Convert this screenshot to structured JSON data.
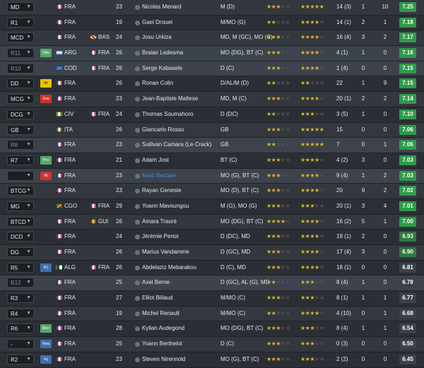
{
  "colors": {
    "rating_high": "#2f9a4a",
    "rating_mid": "#2f7a3f",
    "rating_low": "#3b4148",
    "star_filled": "#e0b52b",
    "link_name": "#3b8fe0",
    "france": [
      "#0055a4",
      "#ffffff",
      "#ef4135"
    ]
  },
  "players": [
    {
      "pos": "MD",
      "role": "",
      "role_color": "",
      "nat": "FRA",
      "flag": "fra",
      "nat2": "",
      "flag2": "",
      "age": "23",
      "name": "Nicolas Menard",
      "position": "M (D)",
      "ca": "★★★☆☆",
      "pa": "★★★★★",
      "apps": "14 (3)",
      "goals": "1",
      "assists": "10",
      "rating": "7.25",
      "rating_color": "#2f9a4a",
      "rating_text": "#ffffff",
      "style": "alt",
      "name_link": false,
      "dim": false
    },
    {
      "pos": "R1",
      "role": "",
      "role_color": "",
      "nat": "FRA",
      "flag": "fra",
      "nat2": "",
      "flag2": "",
      "age": "19",
      "name": "Gael Drouet",
      "position": "M/MO (G)",
      "ca": "★★☆☆☆",
      "pa": "★★★★☆",
      "apps": "14 (1)",
      "goals": "2",
      "assists": "1",
      "rating": "7.18",
      "rating_color": "#2f9a4a",
      "rating_text": "#ffffff",
      "style": "base",
      "name_link": false,
      "dim": false
    },
    {
      "pos": "MCD",
      "role": "",
      "role_color": "",
      "nat": "FRA",
      "flag": "fra",
      "nat2": "BAS",
      "flag2": "bas",
      "age": "24",
      "name": "Josu Urkiza",
      "position": "MD, M (GC), MO (C)",
      "ca": "★★★☆☆",
      "pa": "★★★★☆",
      "apps": "16 (4)",
      "goals": "3",
      "assists": "2",
      "rating": "7.17",
      "rating_color": "#2f9a4a",
      "rating_text": "#ffffff",
      "style": "alt",
      "name_link": false,
      "dim": false
    },
    {
      "pos": "R11",
      "role": "Otie",
      "role_color": "#55a86b",
      "nat": "ARG",
      "flag": "arg",
      "nat2": "FRA",
      "flag2": "fra",
      "age": "26",
      "name": "Braian Ledesma",
      "position": "MO (DG), BT (C)",
      "ca": "★★★☆☆",
      "pa": "★★★★☆",
      "apps": "4 (1)",
      "goals": "1",
      "assists": "0",
      "rating": "7.16",
      "rating_color": "#2f9a4a",
      "rating_text": "#ffffff",
      "style": "sel",
      "name_link": false,
      "dim": true
    },
    {
      "pos": "R10",
      "role": "",
      "role_color": "",
      "nat": "COD",
      "flag": "cod",
      "nat2": "FRA",
      "flag2": "fra",
      "age": "26",
      "name": "Serge Kabasele",
      "position": "D (C)",
      "ca": "★★★☆☆",
      "pa": "★★★★☆",
      "apps": "1 (4)",
      "goals": "0",
      "assists": "0",
      "rating": "7.15",
      "rating_color": "#2f9a4a",
      "rating_text": "#ffffff",
      "style": "sel",
      "name_link": false,
      "dim": true
    },
    {
      "pos": "DD",
      "role": "Ar",
      "role_color": "#e8c400",
      "nat": "FRA",
      "flag": "fra",
      "nat2": "",
      "flag2": "",
      "age": "26",
      "name": "Ronan Colin",
      "position": "D/AL/M (D)",
      "ca": "★★☆☆☆",
      "pa": "★★☆☆☆",
      "apps": "22",
      "goals": "1",
      "assists": "9",
      "rating": "7.15",
      "rating_color": "#2f9a4a",
      "rating_text": "#ffffff",
      "style": "base",
      "name_link": false,
      "dim": false
    },
    {
      "pos": "MCG",
      "role": "Sus",
      "role_color": "#d0342c",
      "nat": "FRA",
      "flag": "fra",
      "nat2": "",
      "flag2": "",
      "age": "23",
      "name": "Jean-Baptiste Maltese",
      "position": "MD, M (C)",
      "ca": "★★★☆☆",
      "pa": "★★★★☆",
      "apps": "20 (1)",
      "goals": "2",
      "assists": "2",
      "rating": "7.14",
      "rating_color": "#2f9a4a",
      "rating_text": "#ffffff",
      "style": "alt",
      "name_link": false,
      "dim": false
    },
    {
      "pos": "DCG",
      "role": "",
      "role_color": "",
      "nat": "CIV",
      "flag": "civ",
      "nat2": "FRA",
      "flag2": "fra",
      "age": "24",
      "name": "Thomas Soumahoro",
      "position": "D (DC)",
      "ca": "★★☆☆☆",
      "pa": "★★★☆☆",
      "apps": "3 (5)",
      "goals": "1",
      "assists": "0",
      "rating": "7.10",
      "rating_color": "#2f9a4a",
      "rating_text": "#ffffff",
      "style": "base",
      "name_link": false,
      "dim": false
    },
    {
      "pos": "GB",
      "role": "",
      "role_color": "",
      "nat": "ITA",
      "flag": "ita",
      "nat2": "",
      "flag2": "",
      "age": "26",
      "name": "Giancarlo Rosso",
      "position": "GB",
      "ca": "★★★☆☆",
      "pa": "★★★★★",
      "apps": "15",
      "goals": "0",
      "assists": "0",
      "rating": "7.06",
      "rating_color": "#2f9a4a",
      "rating_text": "#ffffff",
      "style": "alt",
      "name_link": false,
      "dim": false
    },
    {
      "pos": "R8",
      "role": "",
      "role_color": "",
      "nat": "FRA",
      "flag": "fra",
      "nat2": "",
      "flag2": "",
      "age": "23",
      "name": "Sullivan Camara (Le Crack)",
      "position": "GB",
      "ca": "★★☆☆☆",
      "pa": "★★★★★",
      "apps": "7",
      "goals": "0",
      "assists": "1",
      "rating": "7.06",
      "rating_color": "#2f9a4a",
      "rating_text": "#ffffff",
      "style": "sel",
      "name_link": false,
      "dim": true
    },
    {
      "pos": "R7",
      "role": "Pro",
      "role_color": "#55a86b",
      "nat": "FRA",
      "flag": "fra",
      "nat2": "",
      "flag2": "",
      "age": "21",
      "name": "Adam Jost",
      "position": "BT (C)",
      "ca": "★★★☆☆",
      "pa": "★★★★☆",
      "apps": "4 (2)",
      "goals": "3",
      "assists": "0",
      "rating": "7.03",
      "rating_color": "#2f9a4a",
      "rating_text": "#ffffff",
      "style": "base",
      "name_link": false,
      "dim": false
    },
    {
      "pos": "",
      "role": "Nl",
      "role_color": "#d0342c",
      "nat": "FRA",
      "flag": "fra",
      "nat2": "",
      "flag2": "",
      "age": "23",
      "name": "Marc Barzaei",
      "position": "MO (G), BT (C)",
      "ca": "★★★☆☆",
      "pa": "★★★★☆",
      "apps": "9 (4)",
      "goals": "1",
      "assists": "2",
      "rating": "7.03",
      "rating_color": "#2f9a4a",
      "rating_text": "#ffffff",
      "style": "sel",
      "name_link": true,
      "dim": false
    },
    {
      "pos": "BTCG",
      "role": "",
      "role_color": "",
      "nat": "FRA",
      "flag": "fra",
      "nat2": "",
      "flag2": "",
      "age": "23",
      "name": "Rayan Geneste",
      "position": "MO (D), BT (C)",
      "ca": "★★★☆☆",
      "pa": "★★★★☆",
      "apps": "20",
      "goals": "9",
      "assists": "2",
      "rating": "7.02",
      "rating_color": "#2f9a4a",
      "rating_text": "#ffffff",
      "style": "alt",
      "name_link": false,
      "dim": false
    },
    {
      "pos": "MG",
      "role": "",
      "role_color": "",
      "nat": "CGO",
      "flag": "cgo",
      "nat2": "FRA",
      "flag2": "fra",
      "age": "29",
      "name": "Yoann Mavoungou",
      "position": "M (G), MO (G)",
      "ca": "★★★☆☆",
      "pa": "★★★☆☆",
      "apps": "20 (1)",
      "goals": "3",
      "assists": "4",
      "rating": "7.01",
      "rating_color": "#2f9a4a",
      "rating_text": "#ffffff",
      "style": "base",
      "name_link": false,
      "dim": false
    },
    {
      "pos": "BTCD",
      "role": "",
      "role_color": "",
      "nat": "FRA",
      "flag": "fra",
      "nat2": "GUI",
      "flag2": "gui",
      "age": "26",
      "name": "Amara Traoré",
      "position": "MO (DG), BT (C)",
      "ca": "★★★★☆",
      "pa": "★★★★☆",
      "apps": "16 (2)",
      "goals": "5",
      "assists": "1",
      "rating": "7.00",
      "rating_color": "#2f9a4a",
      "rating_text": "#ffffff",
      "style": "alt",
      "name_link": false,
      "dim": false
    },
    {
      "pos": "DCD",
      "role": "",
      "role_color": "",
      "nat": "FRA",
      "flag": "fra",
      "nat2": "",
      "flag2": "",
      "age": "24",
      "name": "Jérémie Penot",
      "position": "D (DC), MD",
      "ca": "★★★☆☆",
      "pa": "★★★★☆",
      "apps": "19 (1)",
      "goals": "2",
      "assists": "0",
      "rating": "6.93",
      "rating_color": "#2f7a3f",
      "rating_text": "#ffffff",
      "style": "base",
      "name_link": false,
      "dim": false
    },
    {
      "pos": "DG",
      "role": "",
      "role_color": "",
      "nat": "FRA",
      "flag": "fra",
      "nat2": "",
      "flag2": "",
      "age": "26",
      "name": "Marius Vandamme",
      "position": "D (GC), MD",
      "ca": "★★★☆☆",
      "pa": "★★★★☆",
      "apps": "17 (4)",
      "goals": "3",
      "assists": "0",
      "rating": "6.90",
      "rating_color": "#2f7a3f",
      "rating_text": "#ffffff",
      "style": "alt",
      "name_link": false,
      "dim": false
    },
    {
      "pos": "R5",
      "role": "RJ",
      "role_color": "#3f6fb0",
      "nat": "ALG",
      "flag": "alg",
      "nat2": "FRA",
      "flag2": "fra",
      "age": "26",
      "name": "Abdelaziz Mebarakou",
      "position": "D (C), MD",
      "ca": "★★★☆☆",
      "pa": "★★★★☆",
      "apps": "18 (1)",
      "goals": "0",
      "assists": "0",
      "rating": "6.81",
      "rating_color": "#3b4148",
      "rating_text": "#ffffff",
      "style": "base",
      "name_link": false,
      "dim": false
    },
    {
      "pos": "R12",
      "role": "",
      "role_color": "",
      "nat": "FRA",
      "flag": "fra",
      "nat2": "",
      "flag2": "",
      "age": "25",
      "name": "Axel Berne",
      "position": "D (GC), AL (G), MD",
      "ca": "★★☆☆☆",
      "pa": "★★★☆☆",
      "apps": "8 (4)",
      "goals": "1",
      "assists": "0",
      "rating": "6.78",
      "rating_color": "#3b4148",
      "rating_text": "#ffffff",
      "style": "sel",
      "name_link": false,
      "dim": true
    },
    {
      "pos": "R3",
      "role": "",
      "role_color": "",
      "nat": "FRA",
      "flag": "fra",
      "nat2": "",
      "flag2": "",
      "age": "27",
      "name": "Elliot Billaud",
      "position": "M/MO (C)",
      "ca": "★★★☆☆",
      "pa": "★★★☆☆",
      "apps": "8 (1)",
      "goals": "1",
      "assists": "1",
      "rating": "6.77",
      "rating_color": "#3b4148",
      "rating_text": "#ffffff",
      "style": "base",
      "name_link": false,
      "dim": false
    },
    {
      "pos": "R4",
      "role": "",
      "role_color": "",
      "nat": "FRA",
      "flag": "fra",
      "nat2": "",
      "flag2": "",
      "age": "19",
      "name": "Michel Renault",
      "position": "M/MO (C)",
      "ca": "★★☆☆☆",
      "pa": "★★★★☆",
      "apps": "4 (10)",
      "goals": "0",
      "assists": "1",
      "rating": "6.68",
      "rating_color": "#3b4148",
      "rating_text": "#ffffff",
      "style": "alt",
      "name_link": false,
      "dim": false
    },
    {
      "pos": "R6",
      "role": "Mon",
      "role_color": "#55a86b",
      "nat": "FRA",
      "flag": "fra",
      "nat2": "",
      "flag2": "",
      "age": "28",
      "name": "Kylian Audegond",
      "position": "MO (DG), BT (C)",
      "ca": "★★★☆☆",
      "pa": "★★★☆☆",
      "apps": "8 (4)",
      "goals": "1",
      "assists": "1",
      "rating": "6.54",
      "rating_color": "#3b4148",
      "rating_text": "#ffffff",
      "style": "base",
      "name_link": false,
      "dim": false
    },
    {
      "pos": "-",
      "role": "Req",
      "role_color": "#3f6fb0",
      "nat": "FRA",
      "flag": "fra",
      "nat2": "",
      "flag2": "",
      "age": "25",
      "name": "Yoann Berthelot",
      "position": "D (C)",
      "ca": "★★★☆☆",
      "pa": "★★★☆☆",
      "apps": "0 (3)",
      "goals": "0",
      "assists": "0",
      "rating": "6.50",
      "rating_color": "#3b4148",
      "rating_text": "#ffffff",
      "style": "alt",
      "name_link": false,
      "dim": false
    },
    {
      "pos": "R2",
      "role": "Inj",
      "role_color": "#3f6fb0",
      "nat": "FRA",
      "flag": "fra",
      "nat2": "",
      "flag2": "",
      "age": "23",
      "name": "Steven Nirennold",
      "position": "MO (G), BT (C)",
      "ca": "★★★☆☆",
      "pa": "★★★☆☆",
      "apps": "2 (2)",
      "goals": "0",
      "assists": "0",
      "rating": "6.45",
      "rating_color": "#3b4148",
      "rating_text": "#ffffff",
      "style": "base",
      "name_link": false,
      "dim": false
    }
  ]
}
